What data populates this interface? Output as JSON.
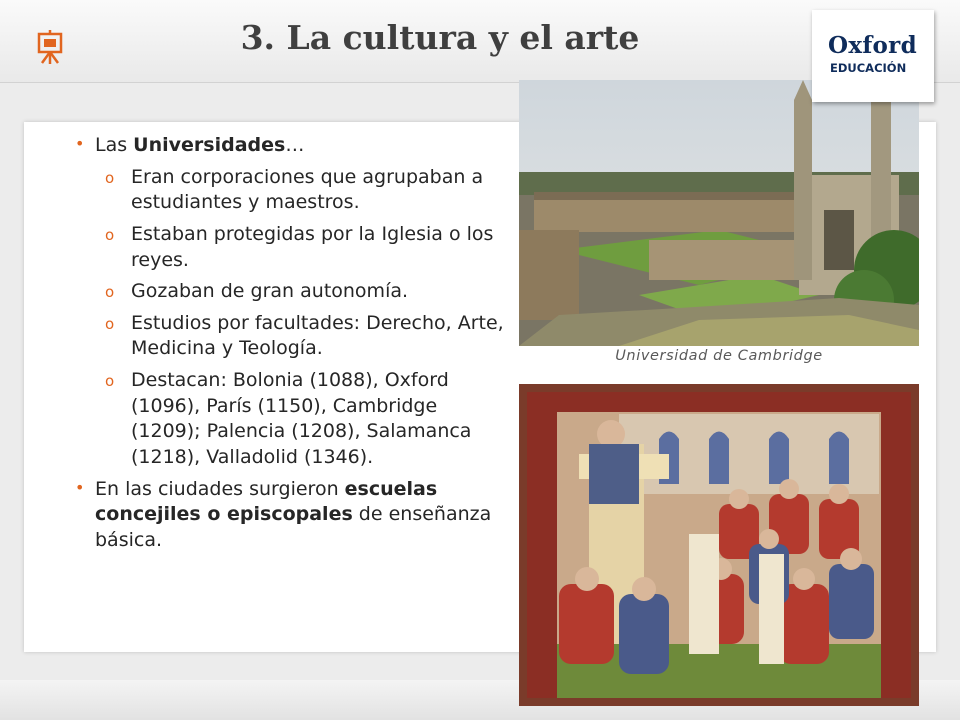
{
  "header": {
    "title": "3. La cultura y el arte",
    "icon": "easel-icon",
    "accent_color": "#e1651f"
  },
  "logo": {
    "line1": "Oxford",
    "line2": "EDUCACIÓN",
    "color": "#0f2c5b"
  },
  "content": {
    "bullet1": {
      "pre": "Las ",
      "bold": "Universidades",
      "post": "…"
    },
    "sub_items": [
      "Eran corporaciones que agrupaban a estudiantes y maestros.",
      "Estaban protegidas por la Iglesia o los reyes.",
      "Gozaban de gran autonomía.",
      "Estudios por facultades: Derecho, Arte, Medicina y Teología.",
      "Destacan: Bolonia (1088), Oxford (1096), París (1150), Cambridge (1209); Palencia (1208), Salamanca (1218), Valladolid (1346)."
    ],
    "bullet2": {
      "pre": "En las ciudades surgieron ",
      "bold": "escuelas concejiles o episcopales",
      "post": " de enseñanza básica."
    }
  },
  "images": {
    "photo1_caption": "Universidad de Cambridge"
  }
}
